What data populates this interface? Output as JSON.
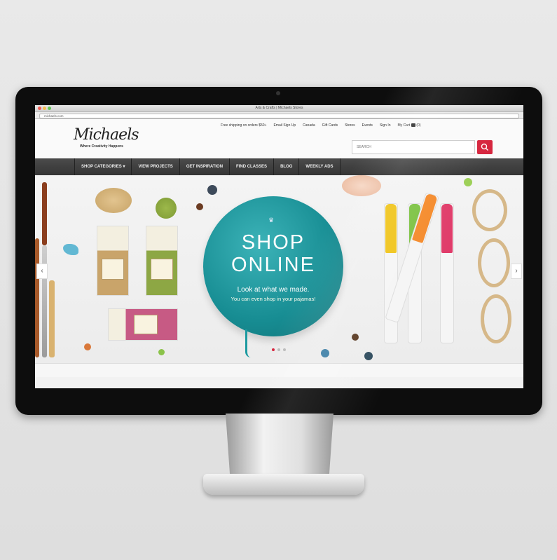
{
  "browser": {
    "window_title": "Arts & Crafts | Michaels Stores",
    "url": "michaels.com",
    "traffic_lights": [
      "#ee5a52",
      "#f5be4f",
      "#62c655"
    ]
  },
  "site": {
    "logo": "Michaels",
    "tagline": "Where Creativity Happens",
    "utility_links": [
      "Free shipping on orders $50+",
      "Email Sign Up",
      "Canada",
      "Gift Cards",
      "Stores",
      "Events",
      "Sign In",
      "My Cart",
      "(0)"
    ],
    "search": {
      "placeholder": "SEARCH"
    },
    "accent_color": "#d6243d"
  },
  "nav": {
    "items": [
      "SHOP CATEGORIES ▾",
      "VIEW PROJECTS",
      "GET INSPIRATION",
      "FIND CLASSES",
      "BLOG",
      "WEEKLY ADS"
    ]
  },
  "hero": {
    "headline_line1": "SHOP",
    "headline_line2": "ONLINE",
    "subheadline": "Look at what we made.",
    "subtext": "You can even shop in your pajamas!",
    "slides": 3,
    "active_slide": 1,
    "prev_icon": "chevron-left-icon",
    "next_icon": "chevron-right-icon"
  }
}
